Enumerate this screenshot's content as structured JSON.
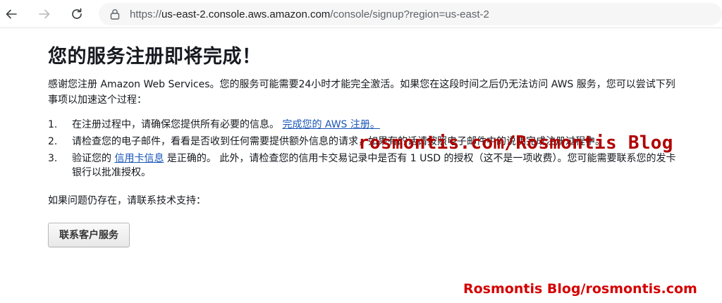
{
  "browser": {
    "back_icon": "arrow-left-icon",
    "forward_icon": "arrow-right-icon",
    "reload_icon": "reload-icon",
    "lock_icon": "lock-icon",
    "url_scheme": "https://",
    "url_host": "us-east-2.console.aws.amazon.com",
    "url_path": "/console/signup?region=us-east-2"
  },
  "page": {
    "title": "您的服务注册即将完成！",
    "intro": "感谢您注册 Amazon Web Services。您的服务可能需要24小时才能完全激活。如果您在这段时间之后仍无法访问 AWS 服务，您可以尝试下列事项以加速这个过程：",
    "steps": [
      {
        "num": "1.",
        "text_before": "在注册过程中，请确保您提供所有必要的信息。",
        "link": "完成您的 AWS 注册。",
        "text_after": ""
      },
      {
        "num": "2.",
        "text_before": "请检查您的电子邮件，看看是否收到任何需要提供额外信息的请求，如果有的话请按照电子邮件中的说明完成注册过程中。",
        "link": "",
        "text_after": ""
      },
      {
        "num": "3.",
        "text_before": "验证您的",
        "link": "信用卡信息",
        "text_after": "是正确的。 此外，请检查您的信用卡交易记录中是否有 1 USD 的授权（这不是一项收费）。您可能需要联系您的发卡银行以批准授权。"
      }
    ],
    "help_text": "如果问题仍存在，请联系技术支持：",
    "contact_button": "联系客户服务"
  },
  "watermarks": {
    "center": "rosmontis.com/Rosmontis Blog",
    "bottom_right": "Rosmontis Blog/rosmontis.com"
  },
  "colors": {
    "link": "#1a56b8",
    "watermark": "#b00000"
  }
}
